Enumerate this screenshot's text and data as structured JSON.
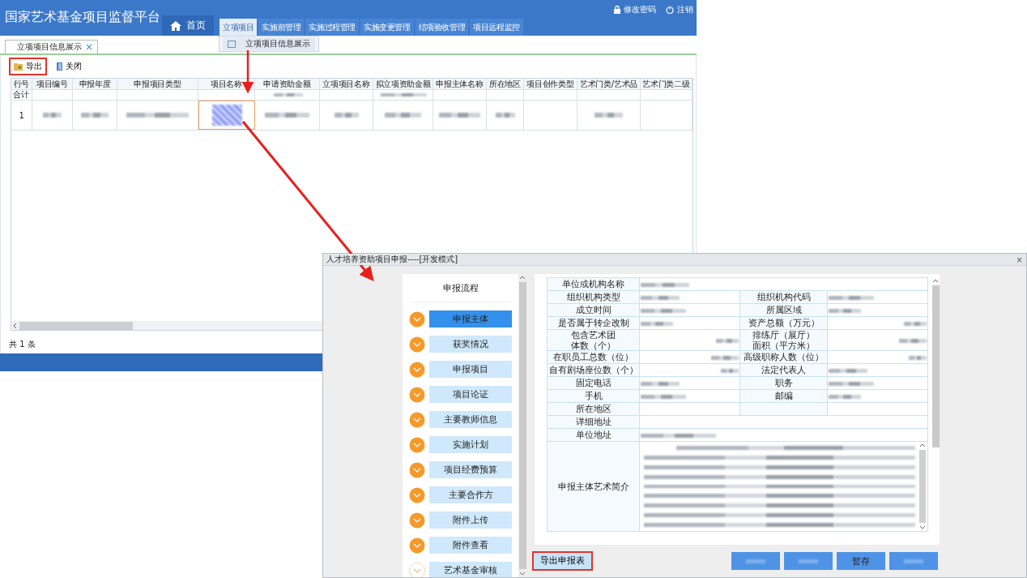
{
  "header": {
    "title": "国家艺术基金项目监督平台",
    "links": [
      "修改密码",
      "注销"
    ],
    "nav": [
      {
        "label": "首页",
        "kind": "home",
        "selected": false
      },
      {
        "label": "立项项目",
        "kind": "tab",
        "selected": true
      },
      {
        "label": "实施前管理",
        "kind": "tab",
        "selected": false
      },
      {
        "label": "实施过程管理",
        "kind": "tab",
        "selected": false
      },
      {
        "label": "实施变更管理",
        "kind": "tab",
        "selected": false
      },
      {
        "label": "结项验收管理",
        "kind": "tab",
        "selected": false
      },
      {
        "label": "项目远程监控",
        "kind": "tab",
        "selected": false
      }
    ],
    "dropdown": [
      "立项项目信息展示"
    ]
  },
  "page_tab": {
    "label": "立项项目信息展示",
    "close": "×"
  },
  "toolbar": [
    {
      "label": "导出",
      "kind": "export",
      "highlighted": true
    },
    {
      "label": "关闭",
      "kind": "close",
      "highlighted": false
    }
  ],
  "table": {
    "columns": [
      "行号",
      "项目编号",
      "申报年度",
      "申报项目类型",
      "项目名称",
      "申请资助金额",
      "立项项目名称",
      "拟立项资助金额",
      "申报主体名称",
      "所在地区",
      "项目创作类型",
      "艺术门类/艺术品",
      "艺术门类二级"
    ],
    "rows": [
      {
        "cells": [
          {
            "kind": "text",
            "text": "合计",
            "highlighted": false
          },
          {
            "kind": "empty",
            "highlighted": false
          },
          {
            "kind": "empty",
            "highlighted": false
          },
          {
            "kind": "empty",
            "highlighted": false
          },
          {
            "kind": "empty",
            "highlighted": false
          },
          {
            "kind": "blurred",
            "highlighted": false
          },
          {
            "kind": "empty",
            "highlighted": false
          },
          {
            "kind": "blurred",
            "highlighted": false
          },
          {
            "kind": "empty",
            "highlighted": false
          },
          {
            "kind": "empty",
            "highlighted": false
          },
          {
            "kind": "empty",
            "highlighted": false
          },
          {
            "kind": "empty",
            "highlighted": false
          },
          {
            "kind": "empty",
            "highlighted": false
          }
        ]
      },
      {
        "cells": [
          {
            "kind": "text",
            "text": "1",
            "highlighted": false
          },
          {
            "kind": "blurred",
            "highlighted": false
          },
          {
            "kind": "blurred",
            "highlighted": false
          },
          {
            "kind": "blurred",
            "highlighted": false
          },
          {
            "kind": "blurred",
            "highlighted": true
          },
          {
            "kind": "blurred",
            "highlighted": false
          },
          {
            "kind": "blurred",
            "highlighted": false
          },
          {
            "kind": "blurred",
            "highlighted": false
          },
          {
            "kind": "blurred",
            "highlighted": false
          },
          {
            "kind": "blurred",
            "highlighted": false
          },
          {
            "kind": "empty",
            "highlighted": false
          },
          {
            "kind": "blurred",
            "highlighted": false
          },
          {
            "kind": "empty",
            "highlighted": false
          }
        ]
      }
    ],
    "count": "共 1 条"
  },
  "dialog": {
    "title": "人才培养资助项目申报----[开发模式]",
    "close": "×",
    "steps_title": "申报流程",
    "steps": [
      {
        "label": "申报主体",
        "selected": true,
        "done": true
      },
      {
        "label": "获奖情况",
        "selected": false,
        "done": true
      },
      {
        "label": "申报项目",
        "selected": false,
        "done": true
      },
      {
        "label": "项目论证",
        "selected": false,
        "done": true
      },
      {
        "label": "主要教师信息",
        "selected": false,
        "done": true
      },
      {
        "label": "实施计划",
        "selected": false,
        "done": true
      },
      {
        "label": "项目经费预算",
        "selected": false,
        "done": true
      },
      {
        "label": "主要合作方",
        "selected": false,
        "done": true
      },
      {
        "label": "附件上传",
        "selected": false,
        "done": true
      },
      {
        "label": "附件查看",
        "selected": false,
        "done": true
      },
      {
        "label": "艺术基金审核",
        "selected": false,
        "done": false
      }
    ],
    "form": [
      {
        "kind": "full",
        "label": [
          "单位或机构名称"
        ],
        "value": {
          "kind": "blurred"
        }
      },
      {
        "kind": "pair",
        "label": [
          "组织机构类型"
        ],
        "value": {
          "kind": "blurred"
        },
        "label2": [
          "组织机构代码"
        ],
        "value2": {
          "kind": "blurred"
        }
      },
      {
        "kind": "pair",
        "label": [
          "成立时间"
        ],
        "value": {
          "kind": "blurred"
        },
        "label2": [
          "所属区域"
        ],
        "value2": {
          "kind": "blurred"
        }
      },
      {
        "kind": "pair",
        "label": [
          "是否属于转企改制"
        ],
        "value": {
          "kind": "blurred"
        },
        "label2": [
          "资产总额（万元）"
        ],
        "value2": {
          "kind": "blurred_number"
        }
      },
      {
        "kind": "pair",
        "label": [
          "包含艺术团",
          "体数（个）"
        ],
        "value": {
          "kind": "blurred_number"
        },
        "label2": [
          "排练厅（展厅）",
          "面积（平方米）"
        ],
        "value2": {
          "kind": "blurred_number"
        }
      },
      {
        "kind": "pair",
        "label": [
          "在职员工总数（位）"
        ],
        "value": {
          "kind": "blurred_number"
        },
        "label2": [
          "高级职称人数（位）"
        ],
        "value2": {
          "kind": "blurred_number"
        }
      },
      {
        "kind": "pair",
        "label": [
          "自有剧场座位数（个）"
        ],
        "value": {
          "kind": "blurred_number"
        },
        "label2": [
          "法定代表人"
        ],
        "value2": {
          "kind": "blurred"
        }
      },
      {
        "kind": "pair",
        "label": [
          "固定电话"
        ],
        "value": {
          "kind": "blurred"
        },
        "label2": [
          "职务"
        ],
        "value2": {
          "kind": "blurred"
        }
      },
      {
        "kind": "pair",
        "label": [
          "手机"
        ],
        "value": {
          "kind": "blurred"
        },
        "label2": [
          "邮编"
        ],
        "value2": {
          "kind": "blurred"
        }
      },
      {
        "kind": "pair",
        "label": [
          "所在地区"
        ],
        "value": {
          "kind": "empty"
        },
        "value2": {
          "kind": "empty"
        }
      },
      {
        "kind": "full",
        "label": [
          "详细地址"
        ],
        "value": {
          "kind": "empty"
        }
      },
      {
        "kind": "full",
        "label": [
          "单位地址"
        ],
        "value": {
          "kind": "blurred"
        }
      },
      {
        "kind": "textarea",
        "label": [
          "申报主体艺术简介"
        ],
        "value": {
          "kind": "blurred"
        }
      }
    ],
    "buttons": [
      {
        "label": "导出申报表",
        "kind": "export"
      },
      {
        "kind": "blurred_action"
      },
      {
        "kind": "blurred_action"
      },
      {
        "label": "暂存",
        "kind": "action"
      },
      {
        "kind": "blurred_action"
      }
    ]
  }
}
